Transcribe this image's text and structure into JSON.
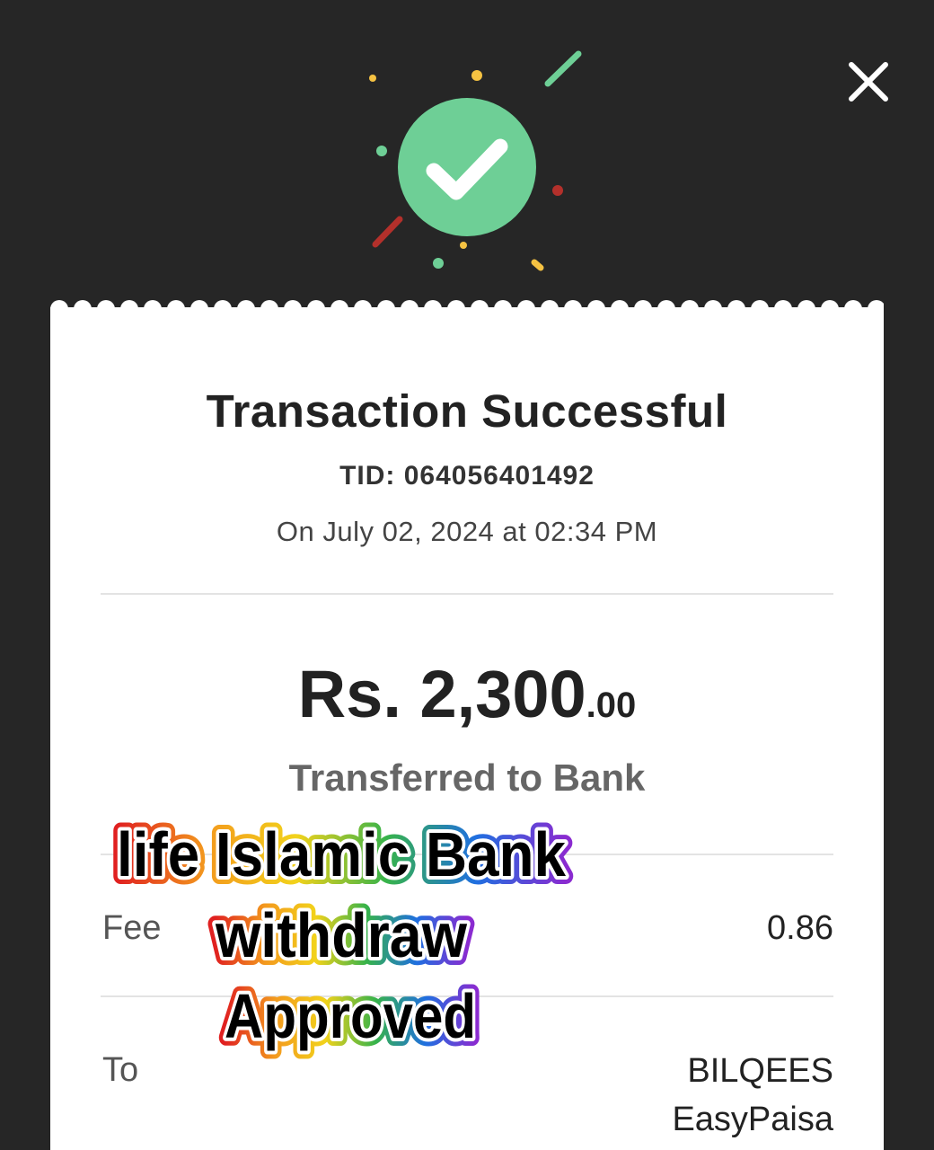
{
  "header": {
    "close_icon": "close-icon",
    "status_icon": "check-circle-icon",
    "accent_color": "#6ecf96"
  },
  "receipt": {
    "title": "Transaction Successful",
    "tid": "TID: 064056401492",
    "date": "On July 02, 2024 at 02:34 PM",
    "amount_main": "Rs. 2,300",
    "amount_cents": ".00",
    "type": "Transferred to Bank",
    "fee_label": "Fee",
    "fee_value": "0.86",
    "to_label": "To",
    "to_name": "BILQEES",
    "to_provider": "EasyPaisa"
  },
  "sticker": {
    "line1": "life Islamic Bank",
    "line2": "withdraw",
    "line3": "Approved"
  }
}
